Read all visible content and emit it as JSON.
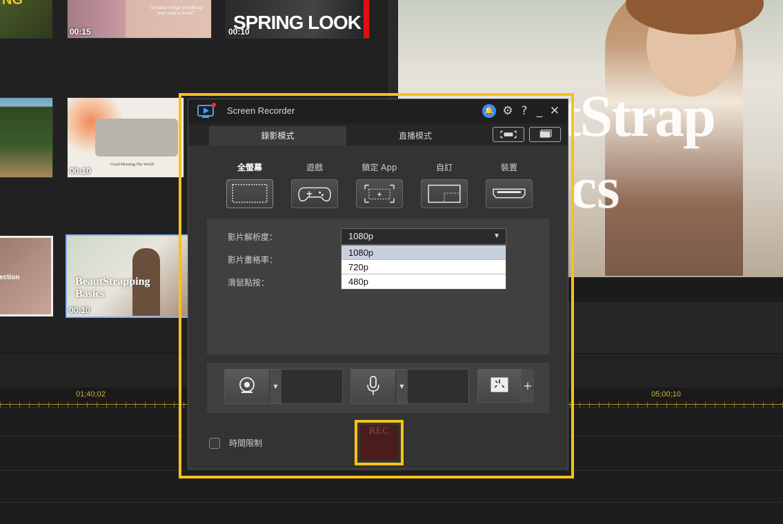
{
  "media": {
    "thumbs": [
      {
        "duration": "",
        "text": "NG"
      },
      {
        "duration": "00:15",
        "text": "\"all basic things to make up your need to know\""
      },
      {
        "duration": "00:10",
        "text": "SPRING LOOK"
      },
      {
        "duration": "",
        "text": ""
      },
      {
        "duration": "00:10",
        "text": "Good Morning The World"
      },
      {
        "duration": "",
        "text": "ection"
      },
      {
        "duration": "00:10",
        "text": "BeautStrapping Basics"
      }
    ]
  },
  "preview": {
    "overlay_text_1": "autStrap",
    "overlay_text_2": "cs"
  },
  "timeline": {
    "ruler_labels": [
      "01;40;02",
      "05;00;10"
    ]
  },
  "recorder": {
    "title": "Screen Recorder",
    "tabs": {
      "record": "錄影模式",
      "live": "直播模式"
    },
    "modes": [
      {
        "label": "全螢幕",
        "icon": "fullscreen-icon"
      },
      {
        "label": "遊戲",
        "icon": "gamepad-icon"
      },
      {
        "label": "鎖定 App",
        "icon": "lock-app-icon"
      },
      {
        "label": "自訂",
        "icon": "custom-region-icon"
      },
      {
        "label": "裝置",
        "icon": "hdmi-device-icon"
      }
    ],
    "settings": {
      "resolution_label": "影片解析度：",
      "framerate_label": "影片畫格率：",
      "mouse_click_label": "滑鼠點按：",
      "resolution_value": "1080p",
      "resolution_options": [
        "1080p",
        "720p",
        "480p"
      ]
    },
    "time_limit_label": "時間限制",
    "rec_label": "REC"
  },
  "colors": {
    "highlight": "#f6c11b",
    "accent": "#3a8cff"
  }
}
